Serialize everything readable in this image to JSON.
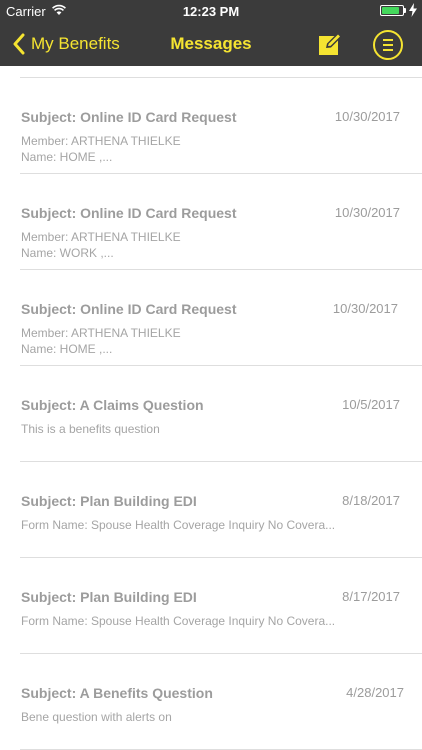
{
  "status_bar": {
    "carrier": "Carrier",
    "time": "12:23 PM",
    "battery_level": 0.86
  },
  "nav": {
    "back_label": "My Benefits",
    "title": "Messages"
  },
  "colors": {
    "accent": "#f5e431",
    "bar": "#3b3b3b",
    "text": "#9c9c9c"
  },
  "icons": {
    "back": "chevron-left-icon",
    "compose": "compose-icon",
    "menu": "menu-icon"
  },
  "messages": [
    {
      "subject": "Subject: Online ID Card Request",
      "date": "10/30/2017",
      "line1": "Member: ARTHENA THIELKE",
      "line2": "Name: HOME ,..."
    },
    {
      "subject": "Subject: Online ID Card Request",
      "date": "10/30/2017",
      "line1": "Member: ARTHENA THIELKE",
      "line2": "Name: WORK ,..."
    },
    {
      "subject": "Subject: Online ID Card Request",
      "date": "10/30/2017",
      "line1": "Member: ARTHENA THIELKE",
      "line2": "Name: HOME ,..."
    },
    {
      "subject": "Subject: A Claims Question",
      "date": "10/5/2017",
      "line1": "This is a benefits question",
      "line2": ""
    },
    {
      "subject": "Subject: Plan Building EDI",
      "date": "8/18/2017",
      "line1": "Form Name: Spouse Health Coverage Inquiry No Covera...",
      "line2": ""
    },
    {
      "subject": "Subject: Plan Building EDI",
      "date": "8/17/2017",
      "line1": "Form Name: Spouse Health Coverage Inquiry No Covera...",
      "line2": ""
    },
    {
      "subject": "Subject: A Benefits Question",
      "date": "4/28/2017",
      "line1": "Bene question with alerts on",
      "line2": ""
    }
  ]
}
